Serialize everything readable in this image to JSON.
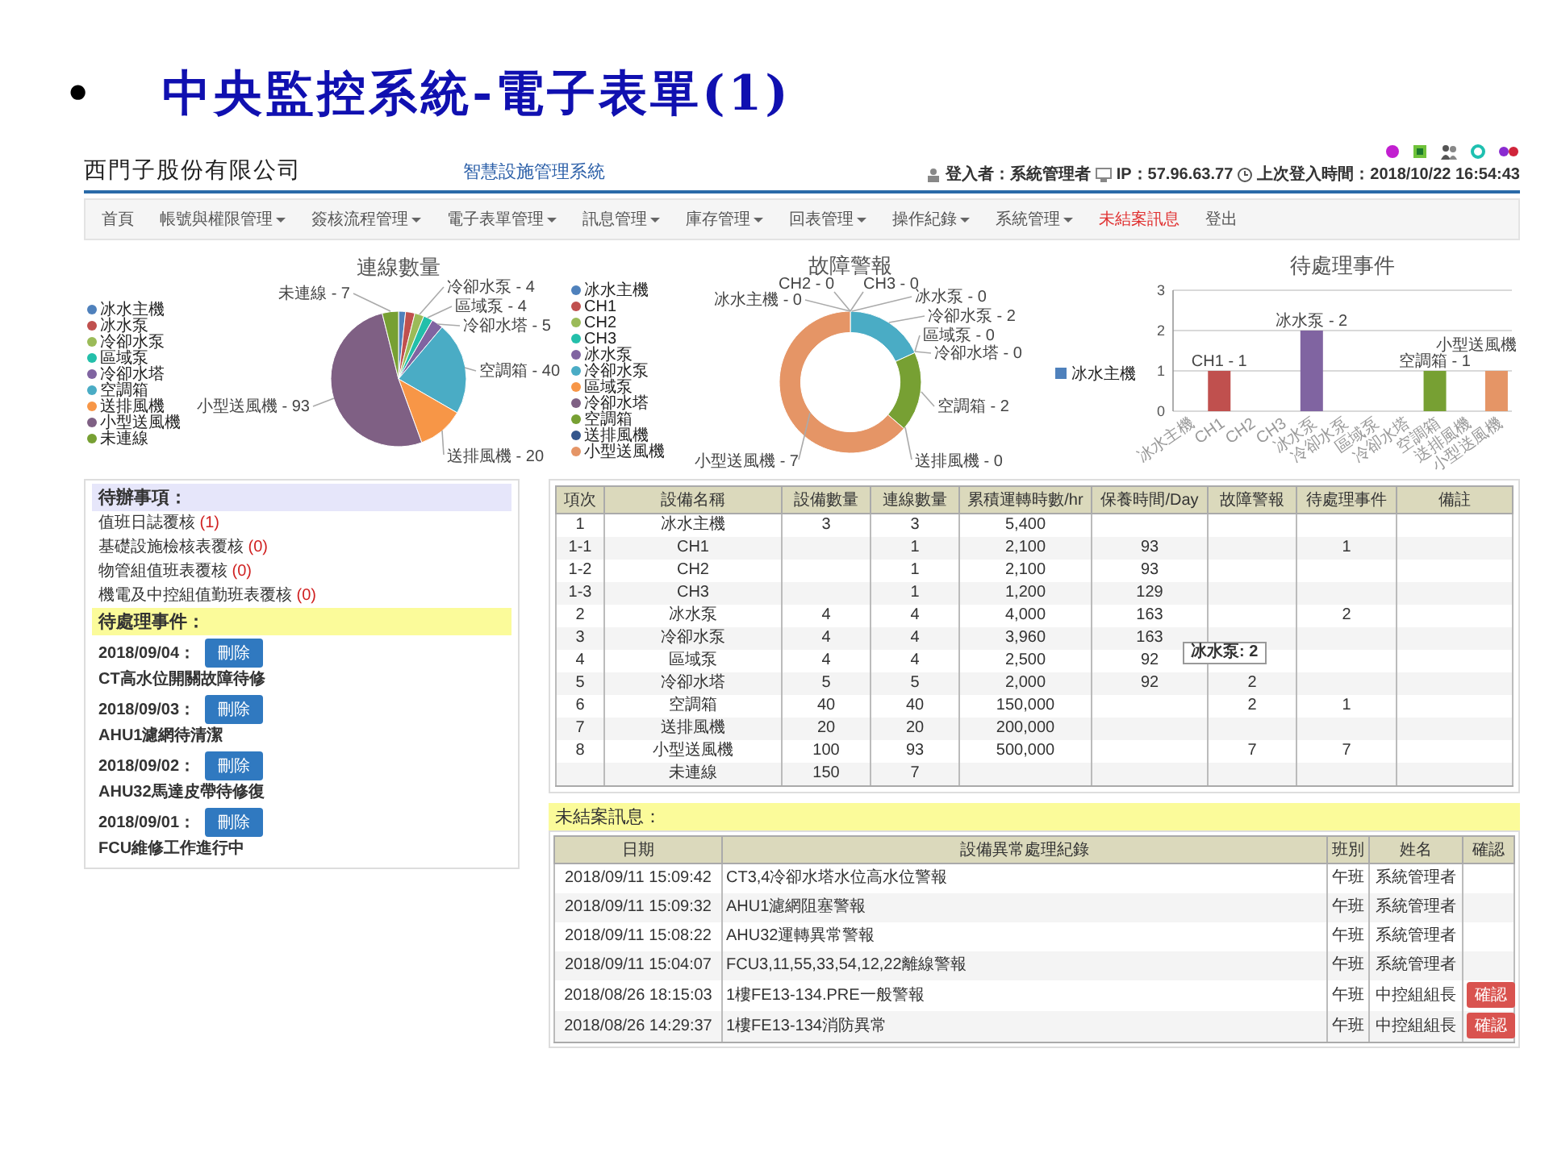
{
  "slide": {
    "bullet": "•",
    "title": "中央監控系統-電子表單(1)"
  },
  "header": {
    "company": "西門子股份有限公司",
    "system_name": "智慧設施管理系統",
    "user": "登入者：系統管理者",
    "ip": "IP：57.96.63.77",
    "last_login": "上次登入時間：2018/10/22 16:54:43"
  },
  "nav": [
    {
      "label": "首頁",
      "dropdown": false,
      "alert": false
    },
    {
      "label": "帳號與權限管理",
      "dropdown": true,
      "alert": false
    },
    {
      "label": "簽核流程管理",
      "dropdown": true,
      "alert": false
    },
    {
      "label": "電子表單管理",
      "dropdown": true,
      "alert": false
    },
    {
      "label": "訊息管理",
      "dropdown": true,
      "alert": false
    },
    {
      "label": "庫存管理",
      "dropdown": true,
      "alert": false
    },
    {
      "label": "回表管理",
      "dropdown": true,
      "alert": false
    },
    {
      "label": "操作紀錄",
      "dropdown": true,
      "alert": false
    },
    {
      "label": "系統管理",
      "dropdown": true,
      "alert": false
    },
    {
      "label": "未結案訊息",
      "dropdown": false,
      "alert": true
    },
    {
      "label": "登出",
      "dropdown": false,
      "alert": false
    }
  ],
  "connection_chart": {
    "chart_data": {
      "type": "pie",
      "title": "連線數量",
      "categories": [
        "冰水主機",
        "冰水泵",
        "冷卻水泵",
        "區域泵",
        "冷卻水塔",
        "空調箱",
        "送排風機",
        "小型送風機",
        "未連線"
      ],
      "values": [
        1.67,
        2.22,
        2.22,
        2.22,
        2.78,
        22.22,
        11.11,
        51.67,
        3.89
      ],
      "legend": "left",
      "colors": [
        "#4f81bc",
        "#c0504e",
        "#9bbb58",
        "#23bfaa",
        "#8064a1",
        "#4aacc5",
        "#f79647",
        "#7f6084",
        "#77a033"
      ],
      "annotations": [
        "未連線 - 7",
        "冷卻水泵 - 4",
        "區域泵 - 4",
        "冷卻水塔 - 5",
        "空調箱 - 40",
        "送排風機 - 20",
        "小型送風機 - 93"
      ]
    }
  },
  "fault_chart": {
    "chart_data": {
      "type": "donut",
      "title": "故障警報",
      "categories": [
        "冰水主機",
        "CH1",
        "CH2",
        "CH3",
        "冰水泵",
        "冷卻水泵",
        "區域泵",
        "冷卻水塔",
        "空調箱",
        "送排風機",
        "小型送風機"
      ],
      "values": [
        0,
        0,
        0,
        0,
        0,
        18.18,
        0,
        0,
        18.18,
        0,
        63.64
      ],
      "legend": "left",
      "colors": [
        "#4f81bc",
        "#c0504e",
        "#9bbb58",
        "#23bfaa",
        "#8064a1",
        "#4aacc5",
        "#f79647",
        "#7f6084",
        "#77a033",
        "#33558b",
        "#e59566"
      ],
      "annotations": [
        "冰水主機 - 0",
        "CH2 - 0",
        "CH3 - 0",
        "冰水泵 - 0",
        "冷卻水泵 - 2",
        "區域泵 - 0",
        "冷卻水塔 - 0",
        "空調箱 - 2",
        "送排風機 - 0",
        "小型送風機 - 7"
      ]
    }
  },
  "pending_chart": {
    "chart_data": {
      "type": "bar",
      "title": "待處理事件",
      "categories": [
        "冰水主機",
        "CH1",
        "CH2",
        "CH3",
        "冰水泵",
        "冷卻水泵",
        "區域泵",
        "冷卻水塔",
        "空調箱",
        "送排風機",
        "小型送風機"
      ],
      "series": [
        {
          "name": "冰水主機",
          "values": [
            0,
            1,
            0,
            0,
            2,
            0,
            0,
            0,
            1,
            0,
            1
          ]
        }
      ],
      "colors": [
        "#4f81bc",
        "#c0504e",
        null,
        null,
        "#8064a1",
        null,
        null,
        null,
        "#77a033",
        null,
        "#e59566"
      ],
      "legend": "left",
      "ylim": [
        0,
        3
      ],
      "yticks": [
        0,
        1,
        2,
        3
      ],
      "value_labels": [
        null,
        "CH1 - 1",
        null,
        null,
        "冰水泵 - 2",
        null,
        null,
        null,
        "空調箱 - 1",
        null,
        "小型送風機"
      ]
    }
  },
  "todo_panel": {
    "title": "待辦事項：",
    "items": [
      {
        "label": "值班日誌覆核",
        "count": "(1)"
      },
      {
        "label": "基礎設施檢核表覆核",
        "count": "(0)"
      },
      {
        "label": "物管組值班表覆核",
        "count": "(0)"
      },
      {
        "label": "機電及中控組值勤班表覆核",
        "count": "(0)"
      }
    ]
  },
  "pending_panel": {
    "title": "待處理事件：",
    "events": [
      {
        "date": "2018/09/04：",
        "button": "刪除",
        "description": "CT高水位開關故障待修"
      },
      {
        "date": "2018/09/03：",
        "button": "刪除",
        "description": "AHU1濾網待清潔"
      },
      {
        "date": "2018/09/02：",
        "button": "刪除",
        "description": "AHU32馬達皮帶待修復"
      },
      {
        "date": "2018/09/01：",
        "button": "刪除",
        "description": "FCU維修工作進行中"
      }
    ]
  },
  "equipment_table": {
    "columns": [
      "項次",
      "設備名稱",
      "設備數量",
      "連線數量",
      "累積運轉時數/hr",
      "保養時間/Day",
      "故障警報",
      "待處理事件",
      "備註"
    ],
    "rows": [
      [
        "1",
        "冰水主機",
        "3",
        "3",
        "5,400",
        null,
        null,
        null,
        null
      ],
      [
        "1-1",
        "CH1",
        null,
        "1",
        "2,100",
        "93",
        null,
        "1",
        null
      ],
      [
        "1-2",
        "CH2",
        null,
        "1",
        "2,100",
        "93",
        null,
        null,
        null
      ],
      [
        "1-3",
        "CH3",
        null,
        "1",
        "1,200",
        "129",
        null,
        null,
        null
      ],
      [
        "2",
        "冰水泵",
        "4",
        "4",
        "4,000",
        "163",
        null,
        "2",
        null
      ],
      [
        "3",
        "冷卻水泵",
        "4",
        "4",
        "3,960",
        "163",
        null,
        null,
        null
      ],
      [
        "4",
        "區域泵",
        "4",
        "4",
        "2,500",
        "92",
        null,
        null,
        null
      ],
      [
        "5",
        "冷卻水塔",
        "5",
        "5",
        "2,000",
        "92",
        "2",
        null,
        null
      ],
      [
        "6",
        "空調箱",
        "40",
        "40",
        "150,000",
        null,
        "2",
        "1",
        null
      ],
      [
        "7",
        "送排風機",
        "20",
        "20",
        "200,000",
        null,
        null,
        null,
        null
      ],
      [
        "8",
        "小型送風機",
        "100",
        "93",
        "500,000",
        null,
        "7",
        "7",
        null
      ],
      [
        null,
        "未連線",
        "150",
        "7",
        null,
        null,
        null,
        null,
        null
      ]
    ],
    "tooltip": "冰水泵: 2"
  },
  "open_messages": {
    "title": "未結案訊息：",
    "columns": [
      "日期",
      "設備異常處理紀錄",
      "班別",
      "姓名",
      "確認"
    ],
    "rows": [
      {
        "cells": [
          "2018/09/11 15:09:42",
          "CT3,4冷卻水塔水位高水位警報",
          "午班",
          "系統管理者"
        ]
      },
      {
        "cells": [
          "2018/09/11 15:09:32",
          "AHU1濾網阻塞警報",
          "午班",
          "系統管理者"
        ]
      },
      {
        "cells": [
          "2018/09/11 15:08:22",
          "AHU32運轉異常警報",
          "午班",
          "系統管理者"
        ]
      },
      {
        "cells": [
          "2018/09/11 15:04:07",
          "FCU3,11,55,33,54,12,22離線警報",
          "午班",
          "系統管理者"
        ]
      },
      {
        "cells": [
          "2018/08/26 18:15:03",
          "1樓FE13-134.PRE一般警報",
          "午班",
          "中控組組長"
        ],
        "button": "確認"
      },
      {
        "cells": [
          "2018/08/26 14:29:37",
          "1樓FE13-134消防異常",
          "午班",
          "中控組組長"
        ],
        "button": "確認"
      }
    ]
  }
}
